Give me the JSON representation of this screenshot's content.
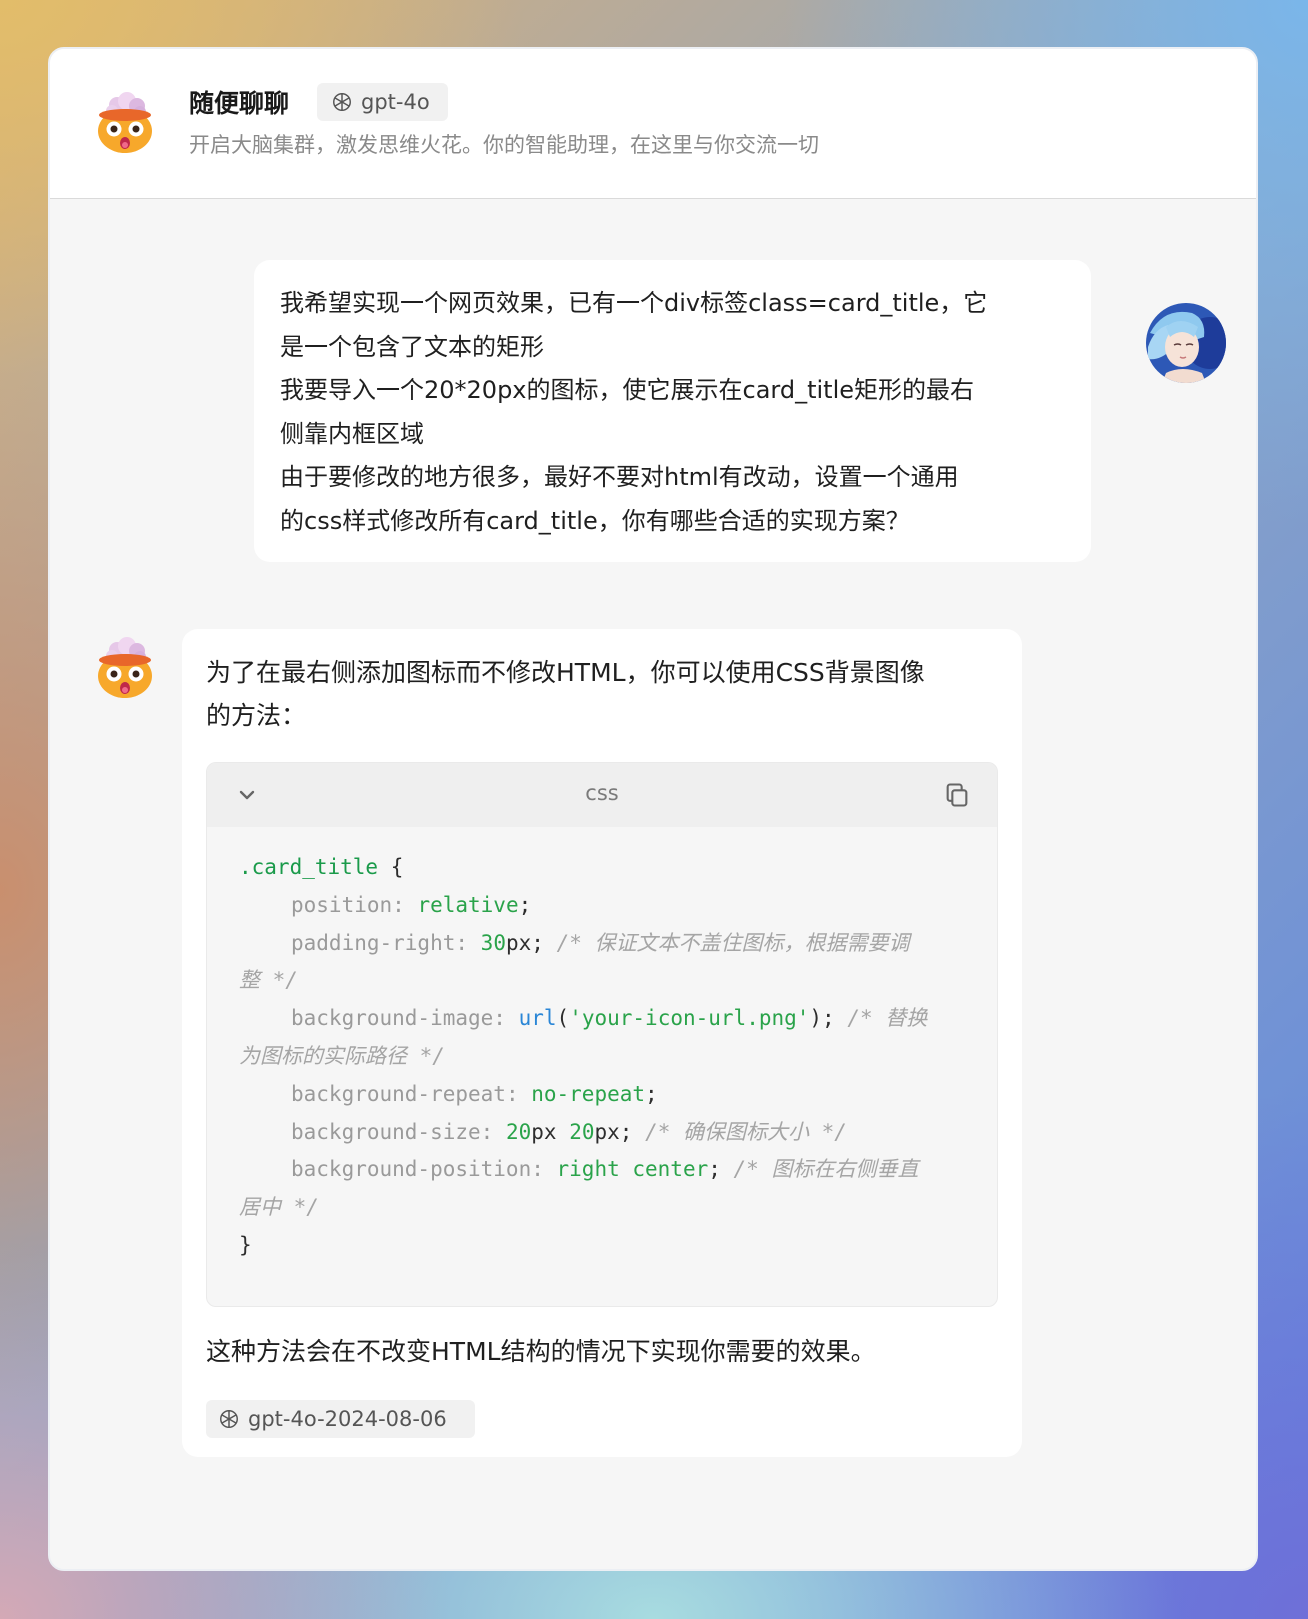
{
  "header": {
    "title": "随便聊聊",
    "model_badge": "gpt-4o",
    "subtitle": "开启大脑集群，激发思维火花。你的智能助理，在这里与你交流一切"
  },
  "user_message": {
    "lines": [
      "我希望实现一个网页效果，已有一个div标签class=card_title，它",
      "是一个包含了文本的矩形",
      "我要导入一个20*20px的图标，使它展示在card_title矩形的最右",
      "侧靠内框区域",
      "由于要修改的地方很多，最好不要对html有改动，设置一个通用",
      "的css样式修改所有card_title，你有哪些合适的实现方案？"
    ]
  },
  "assistant_message": {
    "intro_lines": [
      "为了在最右侧添加图标而不修改HTML，你可以使用CSS背景图像",
      "的方法："
    ],
    "code": {
      "language": "css",
      "selector": ".card_title",
      "open_brace": " {",
      "close_brace": "}",
      "p1": "position",
      "v1": "relative",
      "p2": "padding-right",
      "v2_num": "30",
      "v2_unit": "px",
      "c2a": "/* 保证文本不盖住图标，根据需要调",
      "c2b": "整 */",
      "p3": "background-image",
      "v3_fn": "url",
      "v3_str": "'your-icon-url.png'",
      "c3a": "/* 替换",
      "c3b": "为图标的实际路径 */",
      "p4": "background-repeat",
      "v4": "no-repeat",
      "p5": "background-size",
      "v5_n1": "20",
      "v5_u1": "px",
      "v5_n2": "20",
      "v5_u2": "px",
      "c5": "/* 确保图标大小 */",
      "p6": "background-position",
      "v6": "right center",
      "c6a": "/* 图标在右侧垂直",
      "c6b": "居中 */"
    },
    "outro": "这种方法会在不改变HTML结构的情况下实现你需要的效果。",
    "model_tag": "gpt-4o-2024-08-06"
  },
  "icons": {
    "assistant_avatar": "exploding-head-emoji-icon",
    "user_avatar": "anime-portrait-avatar",
    "model": "openai-logo-icon",
    "collapse": "chevron-down-icon",
    "copy": "copy-icon"
  }
}
